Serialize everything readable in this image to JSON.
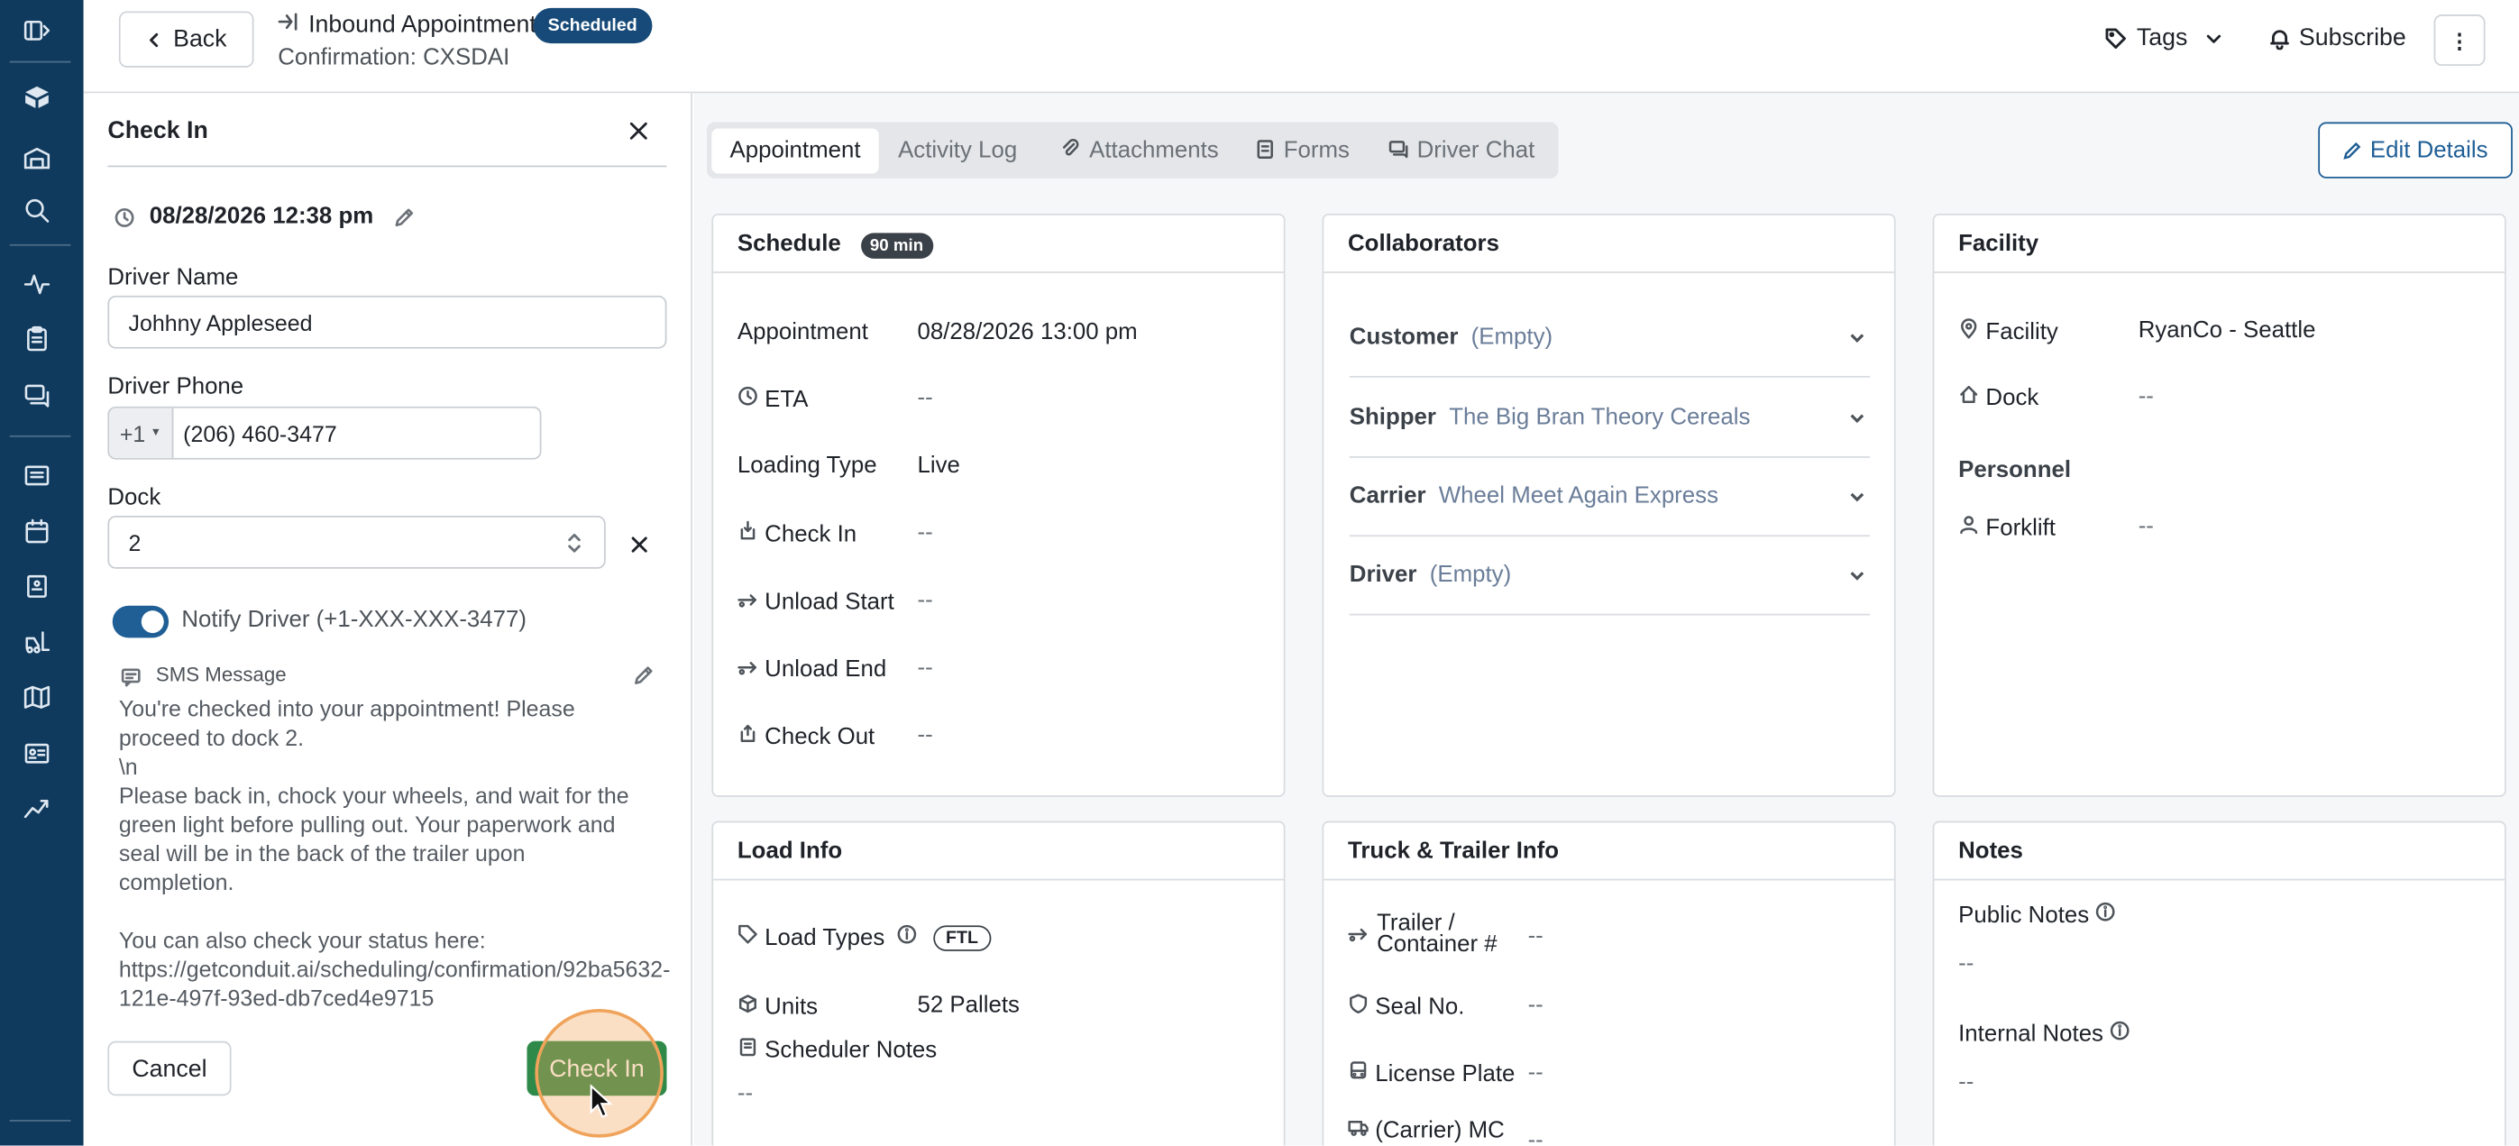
{
  "header": {
    "back_label": "Back",
    "title": "Inbound Appointment",
    "status_badge": "Scheduled",
    "confirmation": "Confirmation: CXSDAI",
    "tags_label": "Tags",
    "subscribe_label": "Subscribe"
  },
  "drawer": {
    "title": "Check In",
    "datetime": "08/28/2026 12:38 pm",
    "driver_name_label": "Driver Name",
    "driver_name_value": "Johhny Appleseed",
    "driver_phone_label": "Driver Phone",
    "phone_country": "+1",
    "phone_value": "(206) 460-3477",
    "dock_label": "Dock",
    "dock_value": "2",
    "notify_label": "Notify Driver (+1-XXX-XXX-3477)",
    "notify_on": true,
    "sms_label": "SMS Message",
    "sms_text": "You're checked into your appointment! Please\nproceed to dock 2.\n\\n\nPlease back in, chock your wheels, and wait for the\ngreen light before pulling out. Your paperwork and\nseal will be in the back of the trailer upon\ncompletion.\n\nYou can also check your status here:\nhttps://getconduit.ai/scheduling/confirmation/92ba5632-\n121e-497f-93ed-db7ced4e9715",
    "cancel_label": "Cancel",
    "check_in_label": "Check In"
  },
  "tabs": [
    "Appointment",
    "Activity Log",
    "Attachments",
    "Forms",
    "Driver Chat"
  ],
  "edit_details_label": "Edit Details",
  "schedule": {
    "title": "Schedule",
    "duration_badge": "90 min",
    "rows": [
      {
        "label": "Appointment",
        "value": "08/28/2026 13:00 pm"
      },
      {
        "label": "ETA",
        "value": "--"
      },
      {
        "label": "Loading Type",
        "value": "Live"
      },
      {
        "label": "Check In",
        "value": "--"
      },
      {
        "label": "Unload Start",
        "value": "--"
      },
      {
        "label": "Unload End",
        "value": "--"
      },
      {
        "label": "Check Out",
        "value": "--"
      }
    ]
  },
  "collaborators": {
    "title": "Collaborators",
    "rows": [
      {
        "label": "Customer",
        "value": "(Empty)"
      },
      {
        "label": "Shipper",
        "value": "The Big Bran Theory Cereals"
      },
      {
        "label": "Carrier",
        "value": "Wheel Meet Again Express"
      },
      {
        "label": "Driver",
        "value": "(Empty)"
      }
    ]
  },
  "facility": {
    "title": "Facility",
    "facility_label": "Facility",
    "facility_value": "RyanCo - Seattle",
    "dock_label": "Dock",
    "dock_value": "--",
    "personnel_label": "Personnel",
    "forklift_label": "Forklift",
    "forklift_value": "--"
  },
  "load_info": {
    "title": "Load Info",
    "load_types_label": "Load Types",
    "load_type_badge": "FTL",
    "units_label": "Units",
    "units_value": "52 Pallets",
    "scheduler_notes_label": "Scheduler Notes",
    "scheduler_notes_value": "--"
  },
  "truck": {
    "title": "Truck & Trailer Info",
    "trailer_label_1": "Trailer /",
    "trailer_label_2": "Container #",
    "trailer_value": "--",
    "seal_label": "Seal No.",
    "seal_value": "--",
    "plate_label": "License Plate",
    "plate_value": "--",
    "mc_label": "(Carrier) MC",
    "mc_value": "--"
  },
  "notes": {
    "title": "Notes",
    "public_label": "Public Notes",
    "public_value": "--",
    "internal_label": "Internal Notes",
    "internal_value": "--"
  },
  "colors": {
    "rail": "#0f3a5e",
    "accent": "#1f5f96",
    "badge": "#174a78",
    "checkin_btn": "#2f8a4a",
    "cursor_ring": "#f0a35a"
  }
}
